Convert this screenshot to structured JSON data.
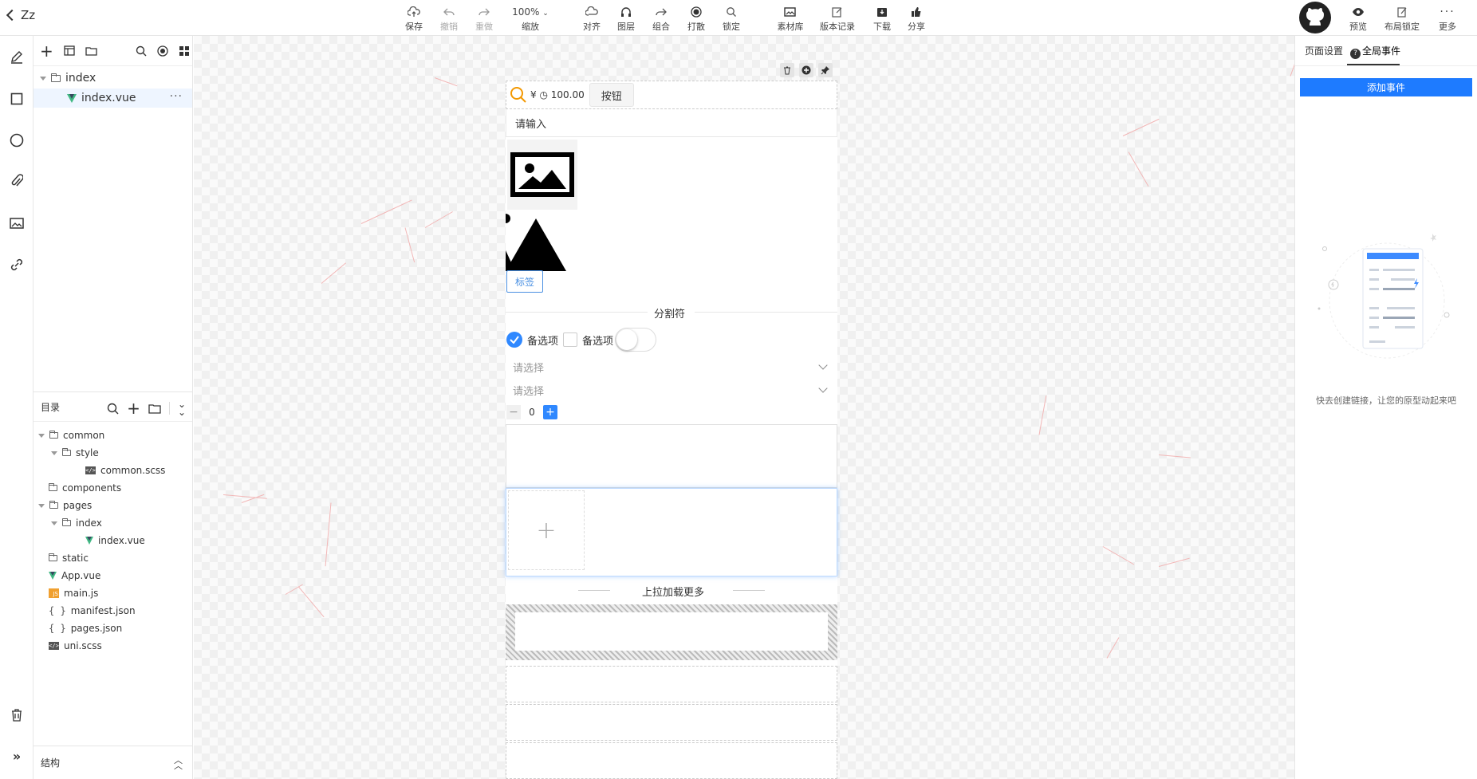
{
  "app": {
    "back_title": "Zz"
  },
  "toolbar": {
    "save": "保存",
    "undo": "撤销",
    "redo": "重做",
    "zoom_value": "100%",
    "zoom_label": "缩放",
    "align": "对齐",
    "layer": "图层",
    "group": "组合",
    "scatter": "打散",
    "lock": "锁定",
    "assets": "素材库",
    "history": "版本记录",
    "download": "下载",
    "share": "分享",
    "preview": "预览",
    "layout_lock": "布局锁定",
    "more": "更多"
  },
  "page_tree": {
    "folder": "index",
    "file": "index.vue"
  },
  "directory": {
    "title": "目录",
    "items": [
      {
        "name": "common",
        "kind": "folder",
        "depth": 0,
        "expanded": true
      },
      {
        "name": "style",
        "kind": "folder",
        "depth": 1,
        "expanded": true
      },
      {
        "name": "common.scss",
        "kind": "code",
        "depth": 2
      },
      {
        "name": "components",
        "kind": "folder",
        "depth": 0
      },
      {
        "name": "pages",
        "kind": "folder",
        "depth": 0,
        "expanded": true
      },
      {
        "name": "index",
        "kind": "folder",
        "depth": 1,
        "expanded": true
      },
      {
        "name": "index.vue",
        "kind": "vue",
        "depth": 2
      },
      {
        "name": "static",
        "kind": "folder",
        "depth": 0
      },
      {
        "name": "App.vue",
        "kind": "vue",
        "depth": 0
      },
      {
        "name": "main.js",
        "kind": "js",
        "depth": 0
      },
      {
        "name": "manifest.json",
        "kind": "json",
        "depth": 0
      },
      {
        "name": "pages.json",
        "kind": "json",
        "depth": 0
      },
      {
        "name": "uni.scss",
        "kind": "code",
        "depth": 0
      }
    ]
  },
  "structure": {
    "title": "结构"
  },
  "phone": {
    "price": "¥ ◷ 100.00",
    "button": "按钮",
    "input_placeholder": "请输入",
    "tag": "标签",
    "divider": "分割符",
    "option1": "备选项",
    "option2": "备选项",
    "select1": "请选择",
    "select2": "请选择",
    "stepper_value": "0",
    "stepper_minus": "−",
    "stepper_plus": "+",
    "upload_plus": "+",
    "load_more": "上拉加载更多"
  },
  "right_panel": {
    "tab_page": "页面设置",
    "tab_global": "全局事件",
    "add_event": "添加事件",
    "empty_text": "快去创建链接，让您的原型动起来吧"
  },
  "colors": {
    "accent": "#2f88ff",
    "primary_button": "#1e7bff",
    "tag_border": "#4a90e2"
  }
}
